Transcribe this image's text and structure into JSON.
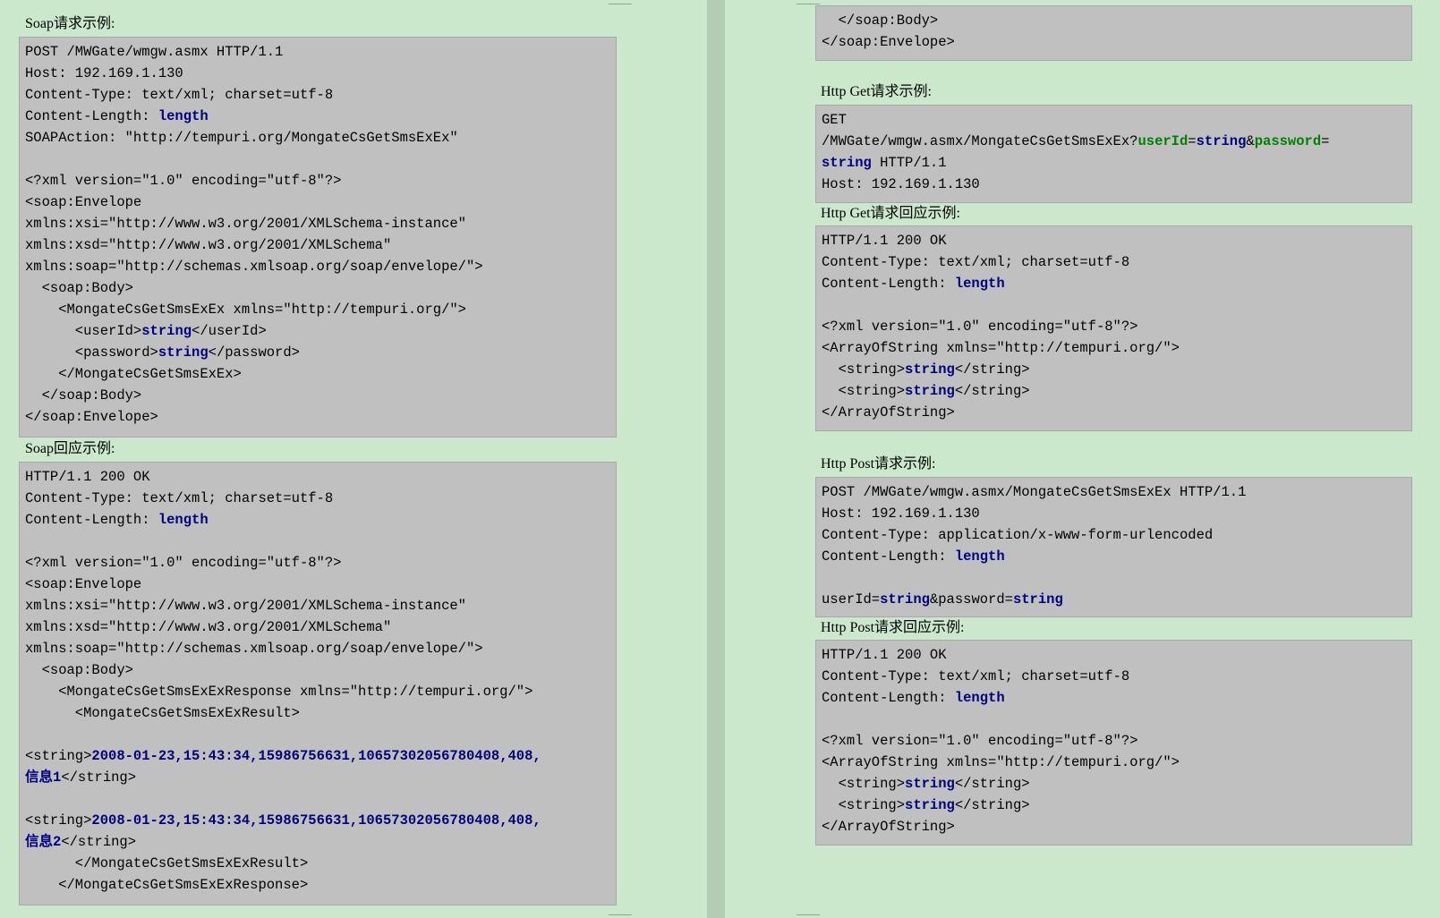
{
  "left": {
    "soap_request": {
      "heading": "Soap请求示例:",
      "lines": [
        [
          {
            "t": "POST /MWGate/wmgw.asmx HTTP/1.1"
          }
        ],
        [
          {
            "t": "Host: 192.169.1.130"
          }
        ],
        [
          {
            "t": "Content-Type: text/xml; charset=utf-8"
          }
        ],
        [
          {
            "t": "Content-Length: "
          },
          {
            "t": "length",
            "c": "kw"
          }
        ],
        [
          {
            "t": "SOAPAction: \"http://tempuri.org/MongateCsGetSmsExEx\""
          }
        ],
        [
          {
            "t": ""
          }
        ],
        [
          {
            "t": "<?xml version=\"1.0\" encoding=\"utf-8\"?>"
          }
        ],
        [
          {
            "t": "<soap:Envelope"
          }
        ],
        [
          {
            "t": "xmlns:xsi=\"http://www.w3.org/2001/XMLSchema-instance\""
          }
        ],
        [
          {
            "t": "xmlns:xsd=\"http://www.w3.org/2001/XMLSchema\""
          }
        ],
        [
          {
            "t": "xmlns:soap=\"http://schemas.xmlsoap.org/soap/envelope/\">"
          }
        ],
        [
          {
            "t": "  <soap:Body>"
          }
        ],
        [
          {
            "t": "    <MongateCsGetSmsExEx xmlns=\"http://tempuri.org/\">"
          }
        ],
        [
          {
            "t": "      <userId>"
          },
          {
            "t": "string",
            "c": "kw"
          },
          {
            "t": "</userId>"
          }
        ],
        [
          {
            "t": "      <password>"
          },
          {
            "t": "string",
            "c": "kw"
          },
          {
            "t": "</password>"
          }
        ],
        [
          {
            "t": "    </MongateCsGetSmsExEx>"
          }
        ],
        [
          {
            "t": "  </soap:Body>"
          }
        ],
        [
          {
            "t": "</soap:Envelope>"
          }
        ]
      ]
    },
    "soap_response": {
      "heading": "Soap回应示例:",
      "lines": [
        [
          {
            "t": "HTTP/1.1 200 OK"
          }
        ],
        [
          {
            "t": "Content-Type: text/xml; charset=utf-8"
          }
        ],
        [
          {
            "t": "Content-Length: "
          },
          {
            "t": "length",
            "c": "kw"
          }
        ],
        [
          {
            "t": ""
          }
        ],
        [
          {
            "t": "<?xml version=\"1.0\" encoding=\"utf-8\"?>"
          }
        ],
        [
          {
            "t": "<soap:Envelope"
          }
        ],
        [
          {
            "t": "xmlns:xsi=\"http://www.w3.org/2001/XMLSchema-instance\""
          }
        ],
        [
          {
            "t": "xmlns:xsd=\"http://www.w3.org/2001/XMLSchema\""
          }
        ],
        [
          {
            "t": "xmlns:soap=\"http://schemas.xmlsoap.org/soap/envelope/\">"
          }
        ],
        [
          {
            "t": "  <soap:Body>"
          }
        ],
        [
          {
            "t": "    <MongateCsGetSmsExExResponse xmlns=\"http://tempuri.org/\">"
          }
        ],
        [
          {
            "t": "      <MongateCsGetSmsExExResult>"
          }
        ],
        [
          {
            "t": ""
          }
        ],
        [
          {
            "t": "<string>"
          },
          {
            "t": "2008-01-23,15:43:34,15986756631,10657302056780408,408,",
            "c": "dt"
          }
        ],
        [
          {
            "t": "信息1",
            "c": "dt"
          },
          {
            "t": "</string>"
          }
        ],
        [
          {
            "t": ""
          }
        ],
        [
          {
            "t": "<string>"
          },
          {
            "t": "2008-01-23,15:43:34,15986756631,10657302056780408,408,",
            "c": "dt"
          }
        ],
        [
          {
            "t": "信息2",
            "c": "dt"
          },
          {
            "t": "</string>"
          }
        ],
        [
          {
            "t": "      </MongateCsGetSmsExExResult>"
          }
        ],
        [
          {
            "t": "    </MongateCsGetSmsExExResponse>"
          }
        ]
      ]
    }
  },
  "right": {
    "soap_tail": {
      "lines": [
        [
          {
            "t": "  </soap:Body>"
          }
        ],
        [
          {
            "t": "</soap:Envelope>"
          }
        ]
      ]
    },
    "get_request": {
      "heading": "Http Get请求示例:",
      "lines": [
        [
          {
            "t": "GET"
          }
        ],
        [
          {
            "t": "/MWGate/wmgw.asmx/MongateCsGetSmsExEx?"
          },
          {
            "t": "userId",
            "c": "gk"
          },
          {
            "t": "="
          },
          {
            "t": "string",
            "c": "kw"
          },
          {
            "t": "&"
          },
          {
            "t": "password",
            "c": "gk"
          },
          {
            "t": "="
          }
        ],
        [
          {
            "t": "string",
            "c": "kw"
          },
          {
            "t": " HTTP/1.1"
          }
        ],
        [
          {
            "t": "Host: 192.169.1.130"
          }
        ]
      ]
    },
    "get_response": {
      "heading": "Http Get请求回应示例:",
      "lines": [
        [
          {
            "t": "HTTP/1.1 200 OK"
          }
        ],
        [
          {
            "t": "Content-Type: text/xml; charset=utf-8"
          }
        ],
        [
          {
            "t": "Content-Length: "
          },
          {
            "t": "length",
            "c": "kw"
          }
        ],
        [
          {
            "t": ""
          }
        ],
        [
          {
            "t": "<?xml version=\"1.0\" encoding=\"utf-8\"?>"
          }
        ],
        [
          {
            "t": "<ArrayOfString xmlns=\"http://tempuri.org/\">"
          }
        ],
        [
          {
            "t": "  <string>"
          },
          {
            "t": "string",
            "c": "kw"
          },
          {
            "t": "</string>"
          }
        ],
        [
          {
            "t": "  <string>"
          },
          {
            "t": "string",
            "c": "kw"
          },
          {
            "t": "</string>"
          }
        ],
        [
          {
            "t": "</ArrayOfString>"
          }
        ]
      ]
    },
    "post_request": {
      "heading": "Http Post请求示例:",
      "lines": [
        [
          {
            "t": "POST /MWGate/wmgw.asmx/MongateCsGetSmsExEx HTTP/1.1"
          }
        ],
        [
          {
            "t": "Host: 192.169.1.130"
          }
        ],
        [
          {
            "t": "Content-Type: application/x-www-form-urlencoded"
          }
        ],
        [
          {
            "t": "Content-Length: "
          },
          {
            "t": "length",
            "c": "kw"
          }
        ],
        [
          {
            "t": ""
          }
        ],
        [
          {
            "t": "userId="
          },
          {
            "t": "string",
            "c": "kw"
          },
          {
            "t": "&password="
          },
          {
            "t": "string",
            "c": "kw"
          }
        ]
      ]
    },
    "post_response": {
      "heading": "Http Post请求回应示例:",
      "lines": [
        [
          {
            "t": "HTTP/1.1 200 OK"
          }
        ],
        [
          {
            "t": "Content-Type: text/xml; charset=utf-8"
          }
        ],
        [
          {
            "t": "Content-Length: "
          },
          {
            "t": "length",
            "c": "kw"
          }
        ],
        [
          {
            "t": ""
          }
        ],
        [
          {
            "t": "<?xml version=\"1.0\" encoding=\"utf-8\"?>"
          }
        ],
        [
          {
            "t": "<ArrayOfString xmlns=\"http://tempuri.org/\">"
          }
        ],
        [
          {
            "t": "  <string>"
          },
          {
            "t": "string",
            "c": "kw"
          },
          {
            "t": "</string>"
          }
        ],
        [
          {
            "t": "  <string>"
          },
          {
            "t": "string",
            "c": "kw"
          },
          {
            "t": "</string>"
          }
        ],
        [
          {
            "t": "</ArrayOfString>"
          }
        ]
      ]
    }
  }
}
